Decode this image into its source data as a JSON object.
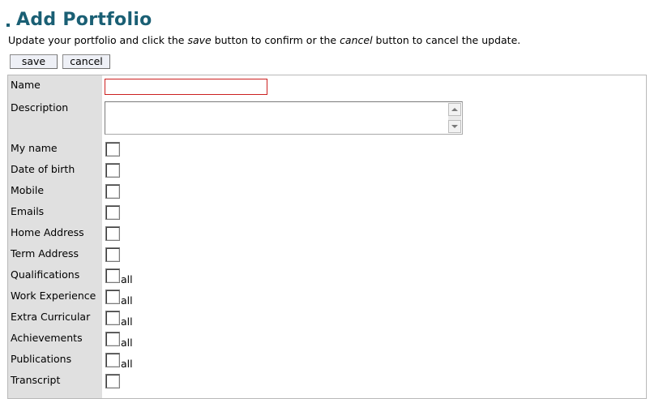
{
  "page": {
    "title": "Add Portfolio",
    "intro": {
      "part1": "Update your portfolio and click the ",
      "save_word": "save",
      "part2": " button to confirm or the ",
      "cancel_word": "cancel",
      "part3": " button to cancel the update."
    }
  },
  "buttons": {
    "save": "save",
    "cancel": "cancel"
  },
  "form": {
    "name_label": "Name",
    "name_value": "",
    "description_label": "Description",
    "description_value": "",
    "fields": [
      {
        "label": "My name",
        "checked": false,
        "all": ""
      },
      {
        "label": "Date of birth",
        "checked": false,
        "all": ""
      },
      {
        "label": "Mobile",
        "checked": false,
        "all": ""
      },
      {
        "label": "Emails",
        "checked": false,
        "all": ""
      },
      {
        "label": "Home Address",
        "checked": false,
        "all": ""
      },
      {
        "label": "Term Address",
        "checked": false,
        "all": ""
      },
      {
        "label": "Qualifications",
        "checked": false,
        "all": "all"
      },
      {
        "label": "Work Experience",
        "checked": false,
        "all": "all"
      },
      {
        "label": "Extra Curricular",
        "checked": false,
        "all": "all"
      },
      {
        "label": "Achievements",
        "checked": false,
        "all": "all"
      },
      {
        "label": "Publications",
        "checked": false,
        "all": "all"
      },
      {
        "label": "Transcript",
        "checked": false,
        "all": ""
      }
    ]
  },
  "colors": {
    "title": "#1a5f74",
    "label_bg": "#e0e0e0",
    "name_border": "#cc2020"
  }
}
